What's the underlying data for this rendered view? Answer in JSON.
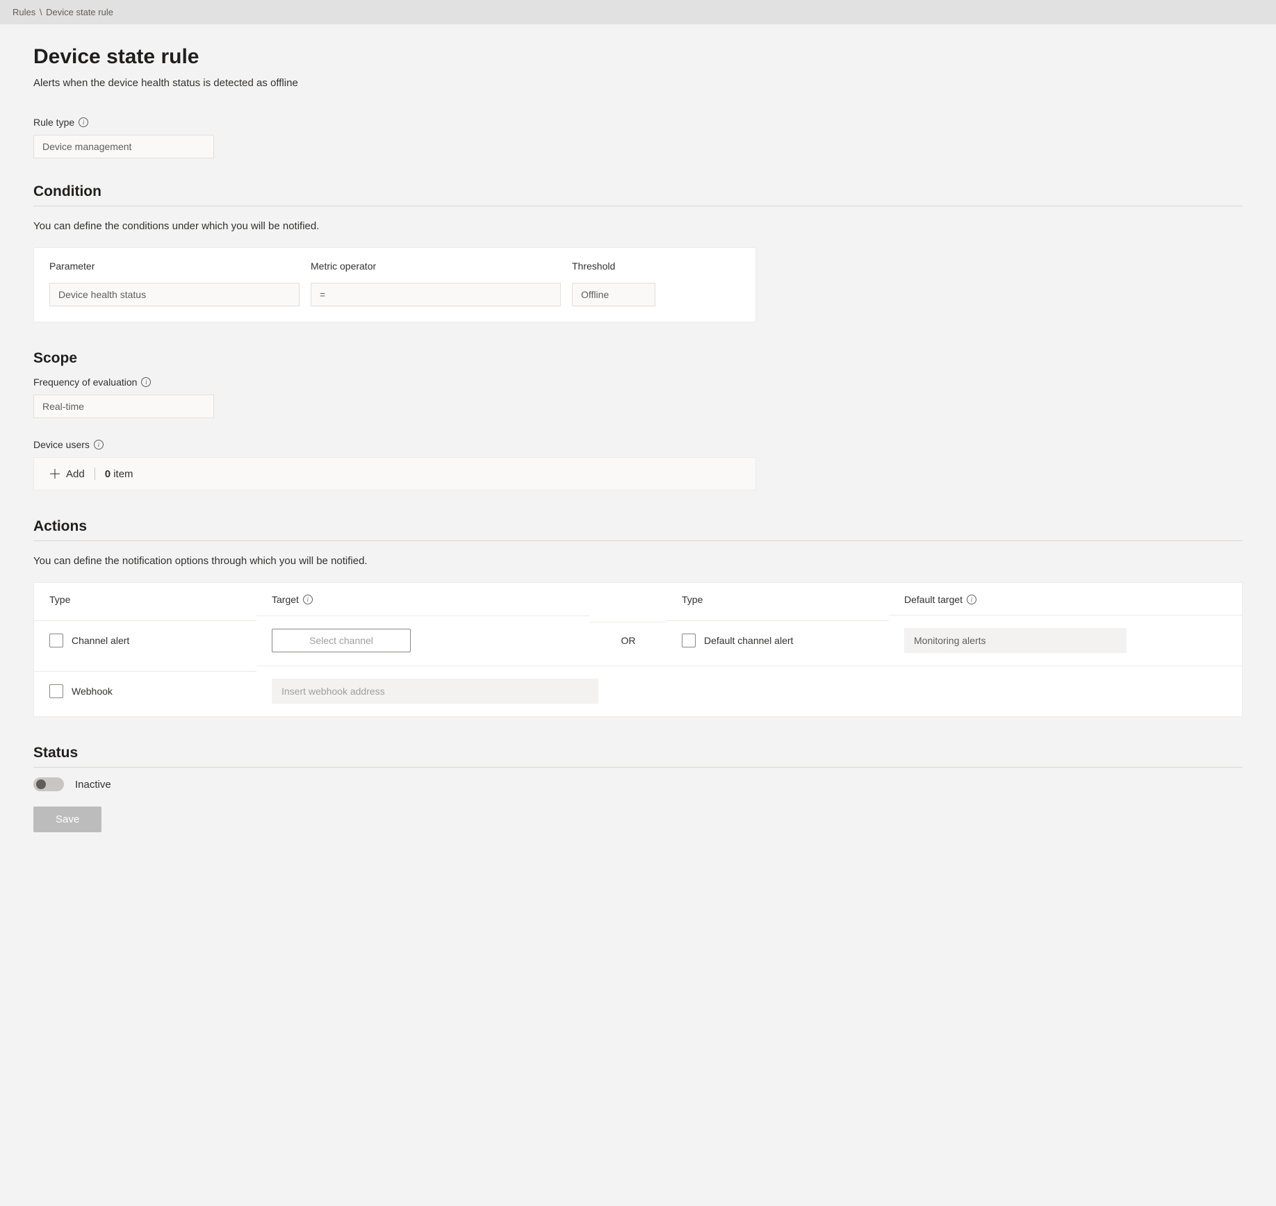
{
  "breadcrumb": {
    "parent": "Rules",
    "separator": "\\",
    "current": "Device state rule"
  },
  "page": {
    "title": "Device state rule",
    "description": "Alerts when the device health status is detected as offline"
  },
  "rule_type": {
    "label": "Rule type",
    "value": "Device management"
  },
  "condition": {
    "title": "Condition",
    "description": "You can define the conditions under which you will be notified.",
    "headers": {
      "parameter": "Parameter",
      "operator": "Metric operator",
      "threshold": "Threshold"
    },
    "row": {
      "parameter": "Device health status",
      "operator": "=",
      "threshold": "Offline"
    }
  },
  "scope": {
    "title": "Scope",
    "frequency_label": "Frequency of evaluation",
    "frequency_value": "Real-time",
    "device_users_label": "Device users",
    "add_label": "Add",
    "count": "0",
    "item_label": "item"
  },
  "actions": {
    "title": "Actions",
    "description": "You can define the notification options through which you will be notified.",
    "headers": {
      "type": "Type",
      "target": "Target",
      "default_target": "Default target"
    },
    "channel_alert_label": "Channel alert",
    "select_channel_label": "Select channel",
    "or_label": "OR",
    "default_channel_alert_label": "Default channel alert",
    "default_target_value": "Monitoring alerts",
    "webhook_label": "Webhook",
    "webhook_placeholder": "Insert webhook address"
  },
  "status": {
    "title": "Status",
    "label": "Inactive",
    "save_label": "Save"
  }
}
